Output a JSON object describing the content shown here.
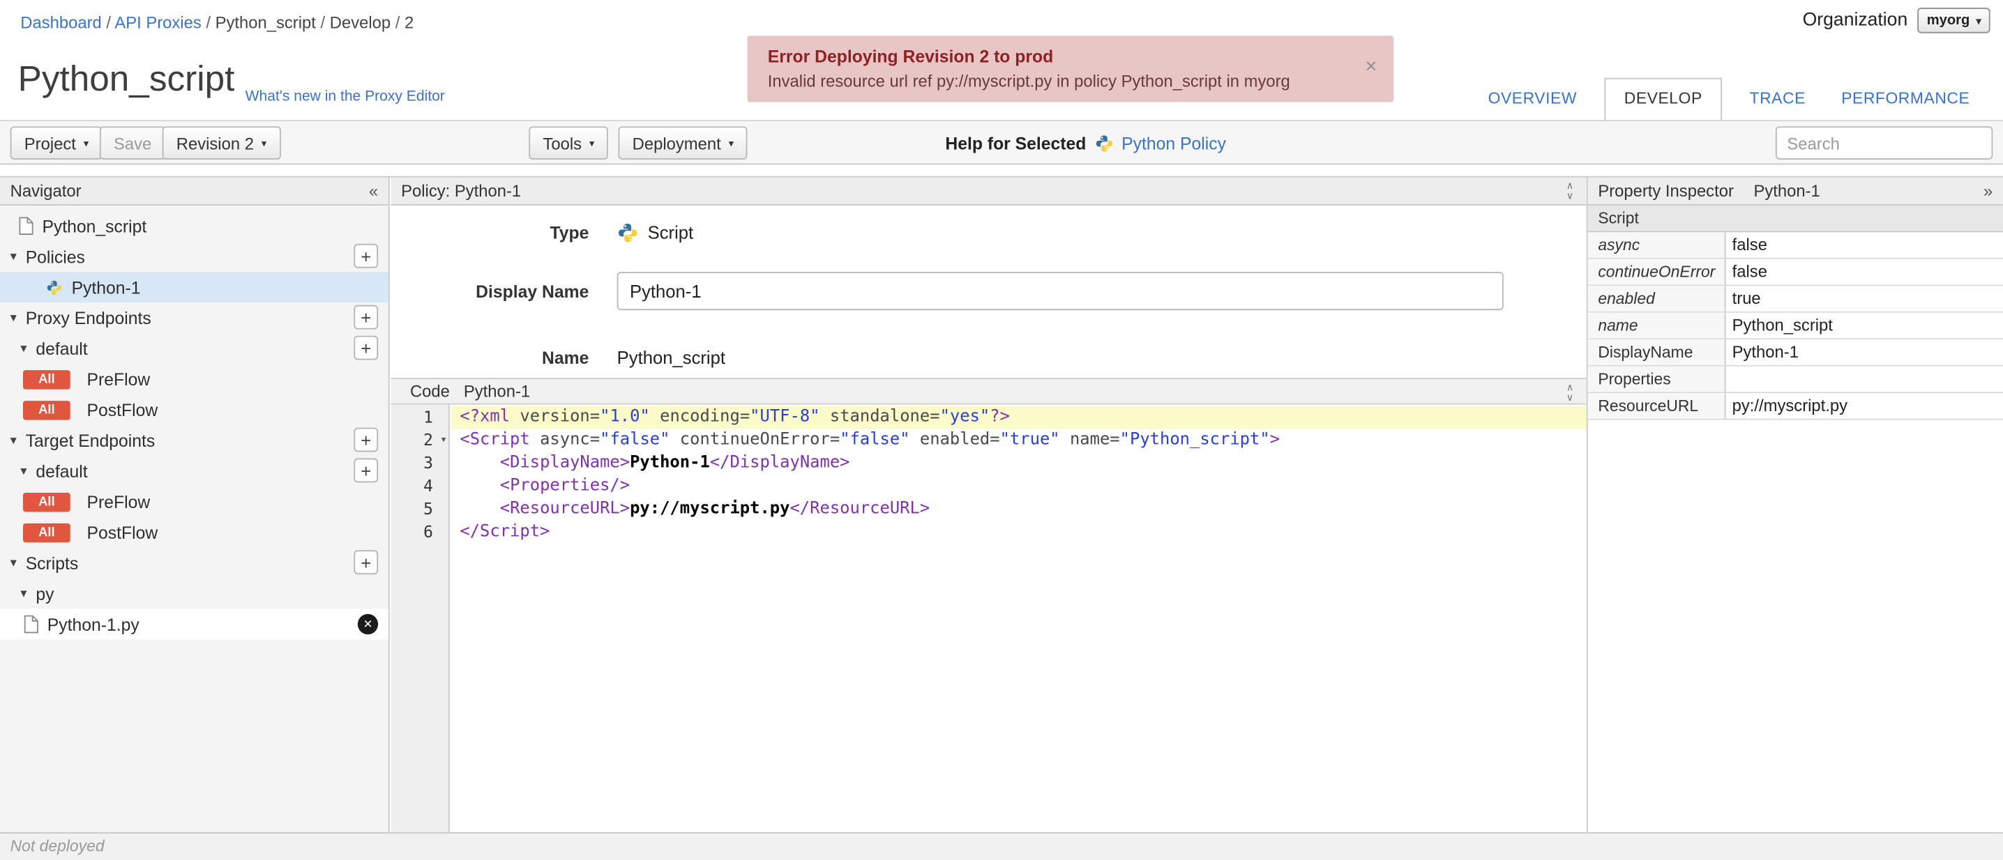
{
  "colors": {
    "link": "#3b73c4",
    "badge": "#e0563f",
    "error_bg": "#e9c6c6",
    "error_title": "#8e2125",
    "error_text": "#66393c",
    "selection": "#d8e7f6",
    "tab_active_text": "#333333",
    "code_tag": "#8033a8",
    "code_attr": "#4a4a4a",
    "code_string": "#2a3fd0",
    "line_highlight": "#fbfbca"
  },
  "icons": {
    "caret_down": "▾",
    "plus": "+",
    "double_left": "«",
    "double_right": "»",
    "chevron_up": "∧",
    "chevron_down": "∨",
    "close_banner": "×",
    "delete": "✕"
  },
  "breadcrumb": {
    "separator": "/",
    "items": [
      {
        "label": "Dashboard",
        "link": true
      },
      {
        "label": "API Proxies",
        "link": true
      },
      {
        "label": "Python_script",
        "link": false
      },
      {
        "label": "Develop",
        "link": false
      },
      {
        "label": "2",
        "link": false
      }
    ]
  },
  "organization": {
    "label": "Organization",
    "value": "myorg"
  },
  "banner": {
    "title": "Error Deploying Revision 2 to prod",
    "message": "Invalid resource url ref py://myscript.py in policy Python_script in myorg"
  },
  "page": {
    "title": "Python_script",
    "whats_new": "What's new in the Proxy Editor"
  },
  "tabs": [
    {
      "label": "OVERVIEW",
      "active": false
    },
    {
      "label": "DEVELOP",
      "active": true
    },
    {
      "label": "TRACE",
      "active": false
    },
    {
      "label": "PERFORMANCE",
      "active": false
    }
  ],
  "toolbar": {
    "project": "Project",
    "save": "Save",
    "revision": "Revision 2",
    "tools": "Tools",
    "deployment": "Deployment",
    "help_label": "Help for Selected",
    "policy_link": "Python Policy",
    "search_placeholder": "Search"
  },
  "navigator": {
    "title": "Navigator",
    "root": "Python_script",
    "policies_label": "Policies",
    "policy_item": "Python-1",
    "proxy_endpoints_label": "Proxy Endpoints",
    "target_endpoints_label": "Target Endpoints",
    "endpoint_default": "default",
    "preflow": "PreFlow",
    "postflow": "PostFlow",
    "flow_badge": "All",
    "scripts_label": "Scripts",
    "py_folder": "py",
    "script_file": "Python-1.py"
  },
  "policy": {
    "header": "Policy: Python-1",
    "type_label": "Type",
    "type_value": "Script",
    "display_name_label": "Display Name",
    "display_name_value": "Python-1",
    "name_label": "Name",
    "name_value": "Python_script",
    "code_label": "Code",
    "code_title": "Python-1"
  },
  "code": {
    "lines": [
      {
        "no": 1,
        "highlight": true,
        "fold": false,
        "tokens": [
          {
            "c": "tag",
            "t": "<?xml "
          },
          {
            "c": "attr",
            "t": "version="
          },
          {
            "c": "str",
            "t": "\"1.0\""
          },
          {
            "c": "attr",
            "t": " encoding="
          },
          {
            "c": "str",
            "t": "\"UTF-8\""
          },
          {
            "c": "attr",
            "t": " standalone="
          },
          {
            "c": "str",
            "t": "\"yes\""
          },
          {
            "c": "tag",
            "t": "?>"
          }
        ]
      },
      {
        "no": 2,
        "highlight": false,
        "fold": true,
        "tokens": [
          {
            "c": "tag",
            "t": "<Script "
          },
          {
            "c": "attr",
            "t": "async="
          },
          {
            "c": "str",
            "t": "\"false\""
          },
          {
            "c": "attr",
            "t": " continueOnError="
          },
          {
            "c": "str",
            "t": "\"false\""
          },
          {
            "c": "attr",
            "t": " enabled="
          },
          {
            "c": "str",
            "t": "\"true\""
          },
          {
            "c": "attr",
            "t": " name="
          },
          {
            "c": "str",
            "t": "\"Python_script\""
          },
          {
            "c": "tag",
            "t": ">"
          }
        ]
      },
      {
        "no": 3,
        "highlight": false,
        "fold": false,
        "tokens": [
          {
            "c": "plain",
            "t": "    "
          },
          {
            "c": "tag",
            "t": "<DisplayName>"
          },
          {
            "c": "text",
            "t": "Python-1"
          },
          {
            "c": "tag",
            "t": "</DisplayName>"
          }
        ]
      },
      {
        "no": 4,
        "highlight": false,
        "fold": false,
        "tokens": [
          {
            "c": "plain",
            "t": "    "
          },
          {
            "c": "tag",
            "t": "<Properties/>"
          }
        ]
      },
      {
        "no": 5,
        "highlight": false,
        "fold": false,
        "tokens": [
          {
            "c": "plain",
            "t": "    "
          },
          {
            "c": "tag",
            "t": "<ResourceURL>"
          },
          {
            "c": "text",
            "t": "py://myscript.py"
          },
          {
            "c": "tag",
            "t": "</ResourceURL>"
          }
        ]
      },
      {
        "no": 6,
        "highlight": false,
        "fold": false,
        "tokens": [
          {
            "c": "tag",
            "t": "</Script>"
          }
        ]
      }
    ]
  },
  "inspector": {
    "title": "Property Inspector",
    "subtitle": "Python-1",
    "section": "Script",
    "rows": [
      {
        "name": "async",
        "value": "false",
        "italic": true
      },
      {
        "name": "continueOnError",
        "value": "false",
        "italic": true
      },
      {
        "name": "enabled",
        "value": "true",
        "italic": true
      },
      {
        "name": "name",
        "value": "Python_script",
        "italic": true
      },
      {
        "name": "DisplayName",
        "value": "Python-1",
        "italic": false
      },
      {
        "name": "Properties",
        "value": "",
        "italic": false
      },
      {
        "name": "ResourceURL",
        "value": "py://myscript.py",
        "italic": false
      }
    ]
  },
  "statusbar": {
    "text": "Not deployed"
  }
}
